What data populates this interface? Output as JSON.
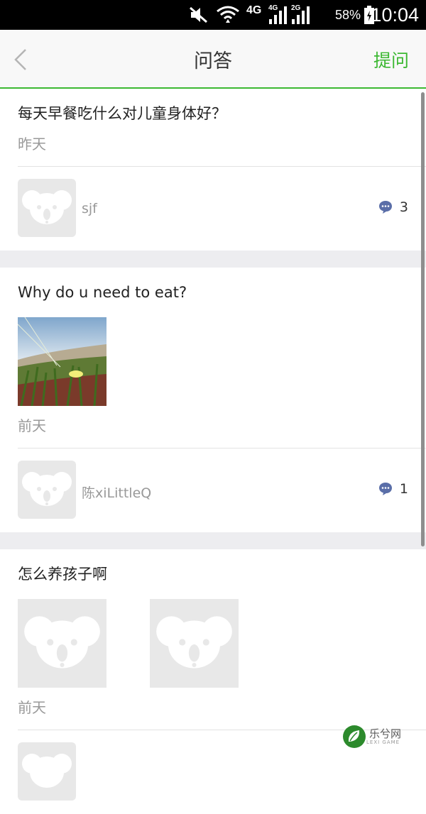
{
  "status_bar": {
    "network_a": "4G",
    "network_b": "4G",
    "network_c": "2G",
    "battery": "58%",
    "time": "10:04"
  },
  "header": {
    "title": "问答",
    "action_label": "提问"
  },
  "colors": {
    "accent": "#3cb832",
    "comment_icon": "#5a6ea8"
  },
  "feed": [
    {
      "title": "每天早餐吃什么对儿童身体好？",
      "time": "昨天",
      "author": "sjf",
      "comments": "3",
      "photos": []
    },
    {
      "title": "Why do u need to eat?",
      "time": "前天",
      "author": "陈xiLittleQ",
      "comments": "1",
      "photos": [
        "landscape-photo"
      ]
    },
    {
      "title": "怎么养孩子啊",
      "time": "前天",
      "author": "",
      "comments": "",
      "photos": [
        "placeholder-koala",
        "placeholder-koala"
      ]
    }
  ],
  "watermark": {
    "logo_text": "乐兮网",
    "logo_sub": "LEXI GAME"
  }
}
